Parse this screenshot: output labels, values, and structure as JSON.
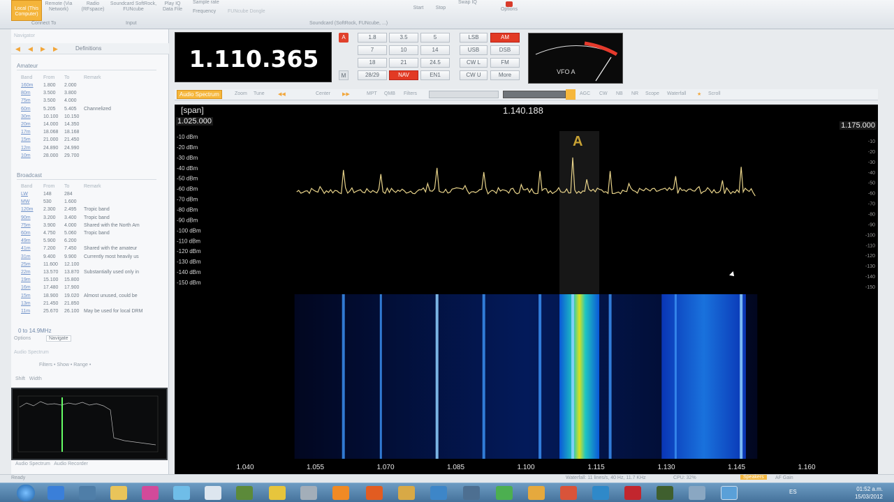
{
  "vfo": {
    "frequency": "1.110.365",
    "label": "VFO A",
    "letter_a": "A",
    "letter_m": "M"
  },
  "keypad": {
    "row1": [
      "1.8",
      "3.5",
      "5"
    ],
    "row2": [
      "7",
      "10",
      "14"
    ],
    "row3": [
      "18",
      "21",
      "24.5"
    ],
    "row4": [
      "28/29",
      "NAV",
      "EN1"
    ],
    "modes_col1": [
      "LSB",
      "USB",
      "CW L",
      "CW U"
    ],
    "modes_col2": [
      "AM",
      "DSB",
      "FM",
      "More"
    ]
  },
  "toolbar": {
    "tab_audio": "Audio Spectrum",
    "zoom": "Zoom",
    "tune": "Tune",
    "center": "Center",
    "mpt": "MPT",
    "qmb": "QMB",
    "filters": "Filters",
    "agc": "AGC",
    "cw": "CW",
    "nb": "NB",
    "nr": "NR",
    "scope": "Scope",
    "waterfall": "Waterfall",
    "scroll": "Scroll"
  },
  "spectrum": {
    "span_label": "[span]",
    "center_freq": "1.140.188",
    "start_freq": "1.025.000",
    "end_freq": "1.175.000",
    "marker": "A",
    "dbm_left": [
      "-10 dBm",
      "-20 dBm",
      "-30 dBm",
      "-40 dBm",
      "-50 dBm",
      "-60 dBm",
      "-70 dBm",
      "-80 dBm",
      "-90 dBm",
      "-100 dBm",
      "-110 dBm",
      "-120 dBm",
      "-130 dBm",
      "-140 dBm",
      "-150 dBm"
    ],
    "dbm_right": [
      "-10",
      "-20",
      "-30",
      "-40",
      "-50",
      "-60",
      "-70",
      "-80",
      "-90",
      "-100",
      "-110",
      "-120",
      "-130",
      "-140",
      "-150"
    ],
    "x_ticks": [
      "1.040",
      "1.055",
      "1.070",
      "1.085",
      "1.100",
      "1.115",
      "1.130",
      "1.145",
      "1.160"
    ]
  },
  "left_panel": {
    "title": "Navigator",
    "definitions": "Definitions",
    "amateur_head": "Amateur",
    "broadcast_head": "Broadcast",
    "col_band": "Band",
    "col_from": "From",
    "col_to": "To",
    "col_remark": "Remark",
    "amateur_rows": [
      {
        "band": "160m",
        "from": "1.800",
        "to": "2.000",
        "remark": ""
      },
      {
        "band": "80m",
        "from": "3.500",
        "to": "3.800",
        "remark": ""
      },
      {
        "band": "75m",
        "from": "3.500",
        "to": "4.000",
        "remark": ""
      },
      {
        "band": "60m",
        "from": "5.205",
        "to": "5.405",
        "remark": "Channelized"
      },
      {
        "band": "30m",
        "from": "10.100",
        "to": "10.150",
        "remark": ""
      },
      {
        "band": "20m",
        "from": "14.000",
        "to": "14.350",
        "remark": ""
      },
      {
        "band": "17m",
        "from": "18.068",
        "to": "18.168",
        "remark": ""
      },
      {
        "band": "15m",
        "from": "21.000",
        "to": "21.450",
        "remark": ""
      },
      {
        "band": "12m",
        "from": "24.890",
        "to": "24.990",
        "remark": ""
      },
      {
        "band": "10m",
        "from": "28.000",
        "to": "29.700",
        "remark": ""
      }
    ],
    "broadcast_rows": [
      {
        "band": "LW",
        "from": "148",
        "to": "284",
        "remark": ""
      },
      {
        "band": "MW",
        "from": "530",
        "to": "1.600",
        "remark": ""
      },
      {
        "band": "120m",
        "from": "2.300",
        "to": "2.495",
        "remark": "Tropic band"
      },
      {
        "band": "90m",
        "from": "3.200",
        "to": "3.400",
        "remark": "Tropic band"
      },
      {
        "band": "75m",
        "from": "3.900",
        "to": "4.000",
        "remark": "Shared with the North Am"
      },
      {
        "band": "60m",
        "from": "4.750",
        "to": "5.060",
        "remark": "Tropic band"
      },
      {
        "band": "49m",
        "from": "5.900",
        "to": "6.200",
        "remark": ""
      },
      {
        "band": "41m",
        "from": "7.200",
        "to": "7.450",
        "remark": "Shared with the amateur"
      },
      {
        "band": "31m",
        "from": "9.400",
        "to": "9.900",
        "remark": "Currently most heavily us"
      },
      {
        "band": "25m",
        "from": "11.600",
        "to": "12.100",
        "remark": ""
      },
      {
        "band": "22m",
        "from": "13.570",
        "to": "13.870",
        "remark": "Substantially used only in"
      },
      {
        "band": "19m",
        "from": "15.100",
        "to": "15.800",
        "remark": ""
      },
      {
        "band": "16m",
        "from": "17.480",
        "to": "17.900",
        "remark": ""
      },
      {
        "band": "15m",
        "from": "18.900",
        "to": "19.020",
        "remark": "Almost unused, could be"
      },
      {
        "band": "13m",
        "from": "21.450",
        "to": "21.850",
        "remark": ""
      },
      {
        "band": "11m",
        "from": "25.670",
        "to": "26.100",
        "remark": "May be used for local DRM"
      }
    ],
    "range_text": "0 to 14.9MHz",
    "tab_options": "Options",
    "tab_navigate": "Navigate",
    "audio_spectrum_title": "Audio Spectrum",
    "audio_tabs": "Filters • Show • Range •",
    "shift_width": "Shift   Width",
    "audio_bottom_tabs": "Audio Spectrum   Audio Recorder"
  },
  "ribbon": {
    "local": "Local (This Computer)",
    "remote": "Remote (Via Network)",
    "radio": "Radio (RFspace)",
    "soundcard": "Soundcard SoftRock, FUNcube",
    "playiq": "Play IQ Data File",
    "sample_rate_label": "Sample rate",
    "frequency_label": "Frequency",
    "frequency_value": "FUNcube Dongle",
    "group_connect": "Connect To",
    "group_input": "Input",
    "group_soundcard": "Soundcard (SoftRock, FUNcube, ...)",
    "start": "Start",
    "stop": "Stop",
    "swap_iq": "Swap IQ",
    "options": "Options"
  },
  "status": {
    "status_left": "Ready",
    "waterfall": "Waterfall: 11 lines/s, 40 Hz, 11.7 KHz",
    "cpu": "CPU: 32%",
    "speakers": "Speakers",
    "af_gain": "AF Gain"
  },
  "taskbar": {
    "lang": "ES",
    "time": "01:52 a.m.",
    "date": "15/03/2012"
  },
  "chart_data": {
    "type": "line",
    "title": "",
    "xlabel": "",
    "ylabel": "",
    "x_range_mhz": [
      1.025,
      1.175
    ],
    "ylim": [
      -150,
      -10
    ],
    "y_ticks_dbm": [
      -10,
      -20,
      -30,
      -40,
      -50,
      -60,
      -70,
      -80,
      -90,
      -100,
      -110,
      -120,
      -130,
      -140,
      -150
    ],
    "x_ticks": [
      1.04,
      1.055,
      1.07,
      1.085,
      1.1,
      1.115,
      1.13,
      1.145,
      1.16
    ],
    "series": [
      {
        "x": [
          1.051,
          1.056,
          1.061,
          1.066,
          1.069,
          1.074,
          1.079,
          1.081,
          1.087,
          1.091,
          1.095,
          1.099,
          1.103,
          1.107,
          1.11,
          1.113,
          1.118,
          1.122,
          1.127,
          1.132,
          1.137,
          1.142,
          1.146,
          1.149
        ],
        "y": [
          -63,
          -58,
          -42,
          -60,
          -46,
          -62,
          -55,
          -40,
          -57,
          -44,
          -61,
          -56,
          -43,
          -59,
          -30,
          -51,
          -43,
          -55,
          -60,
          -48,
          -58,
          -52,
          -39,
          -67
        ]
      }
    ],
    "grid": false
  }
}
